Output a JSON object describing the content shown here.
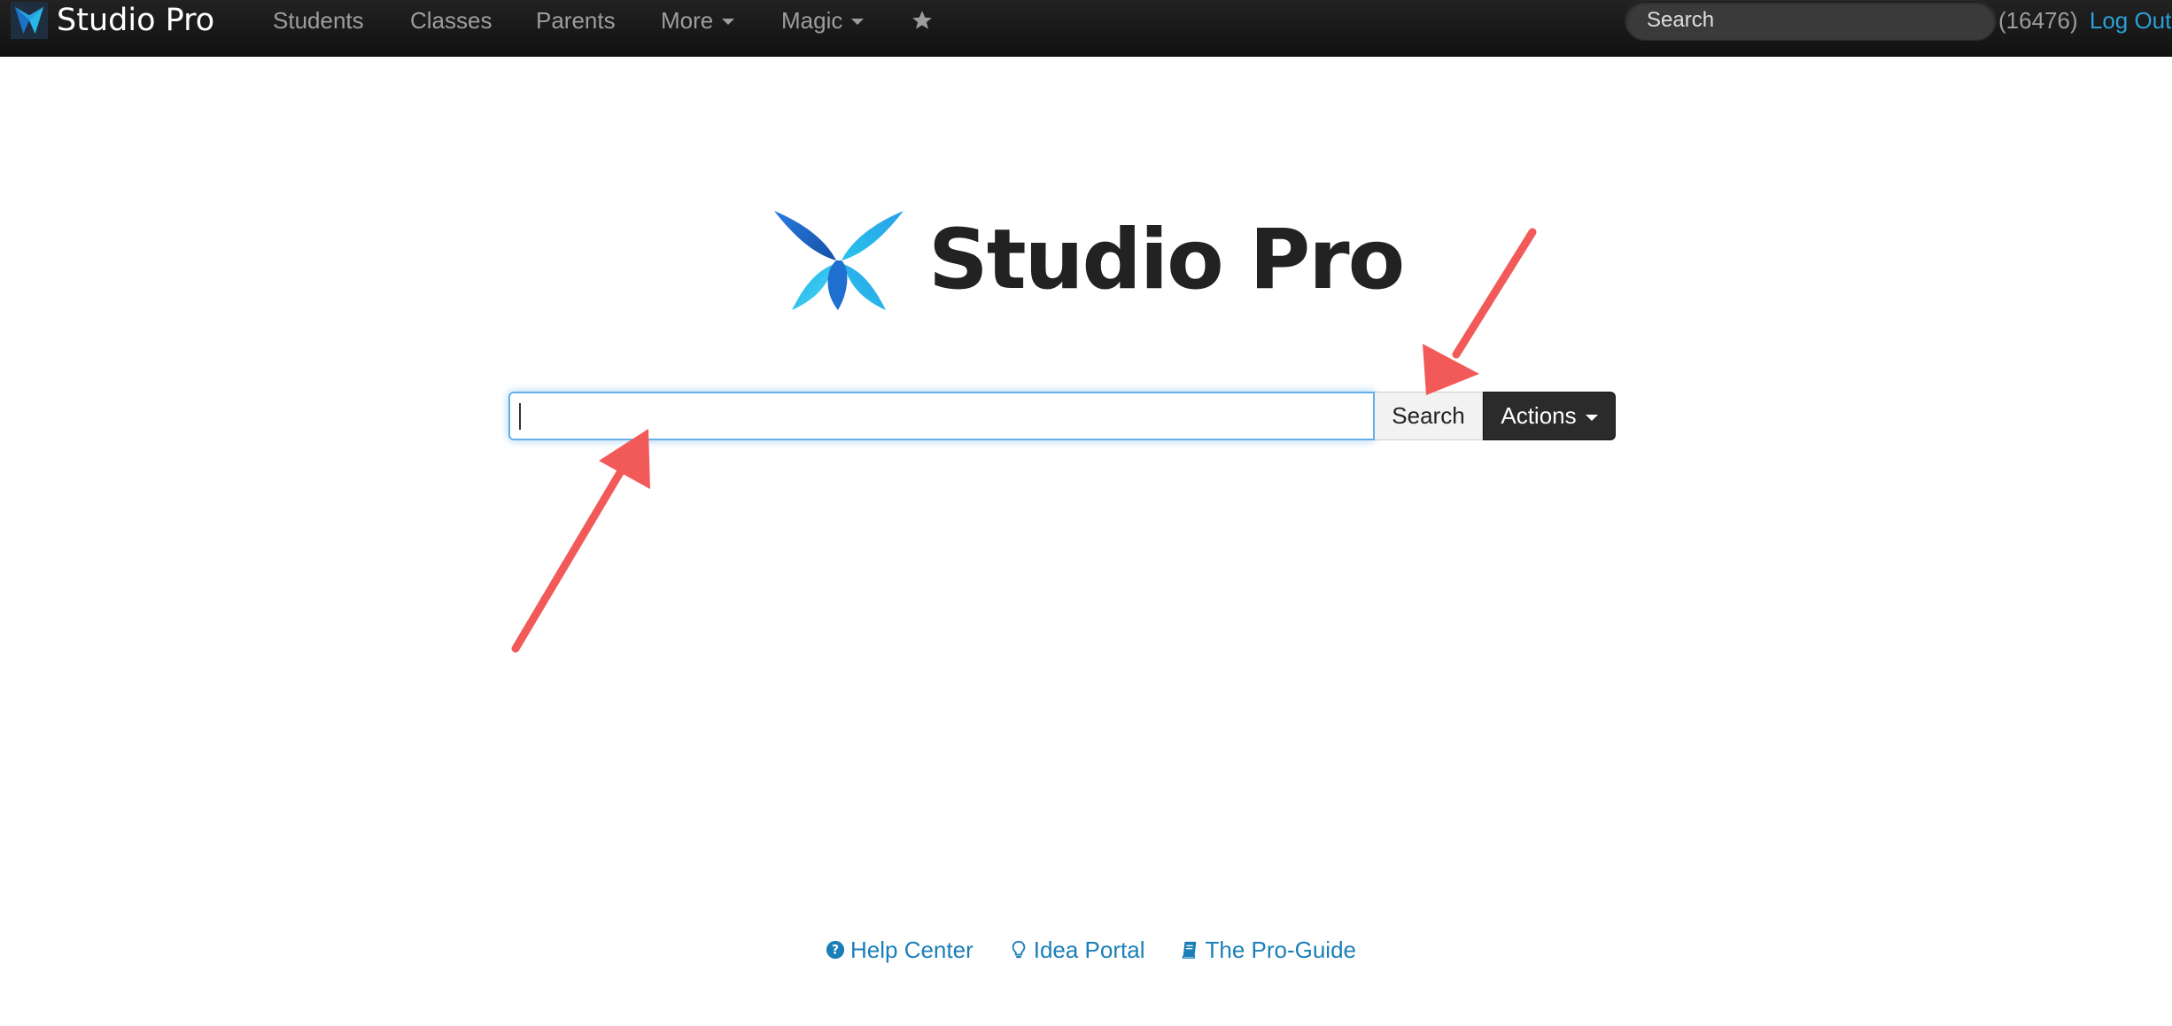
{
  "navbar": {
    "brand": "Studio Pro",
    "items": [
      {
        "label": "Students"
      },
      {
        "label": "Classes"
      },
      {
        "label": "Parents"
      },
      {
        "label": "More"
      },
      {
        "label": "Magic"
      }
    ],
    "search_placeholder": "Search",
    "count": "(16476)",
    "logout_label": "Log Out"
  },
  "main": {
    "title": "Studio Pro",
    "search_value": "",
    "search_button": "Search",
    "actions_button": "Actions"
  },
  "footer": {
    "links": [
      {
        "label": "Help Center",
        "icon": "question-circle-icon"
      },
      {
        "label": "Idea Portal",
        "icon": "lightbulb-icon"
      },
      {
        "label": "The Pro-Guide",
        "icon": "book-icon"
      }
    ]
  },
  "colors": {
    "navbar_bg": "#111111",
    "link_blue": "#2a9fd6",
    "footer_link": "#1a7fb9",
    "annotation_arrow": "#f25a5a",
    "focus_border": "#66afe9"
  }
}
